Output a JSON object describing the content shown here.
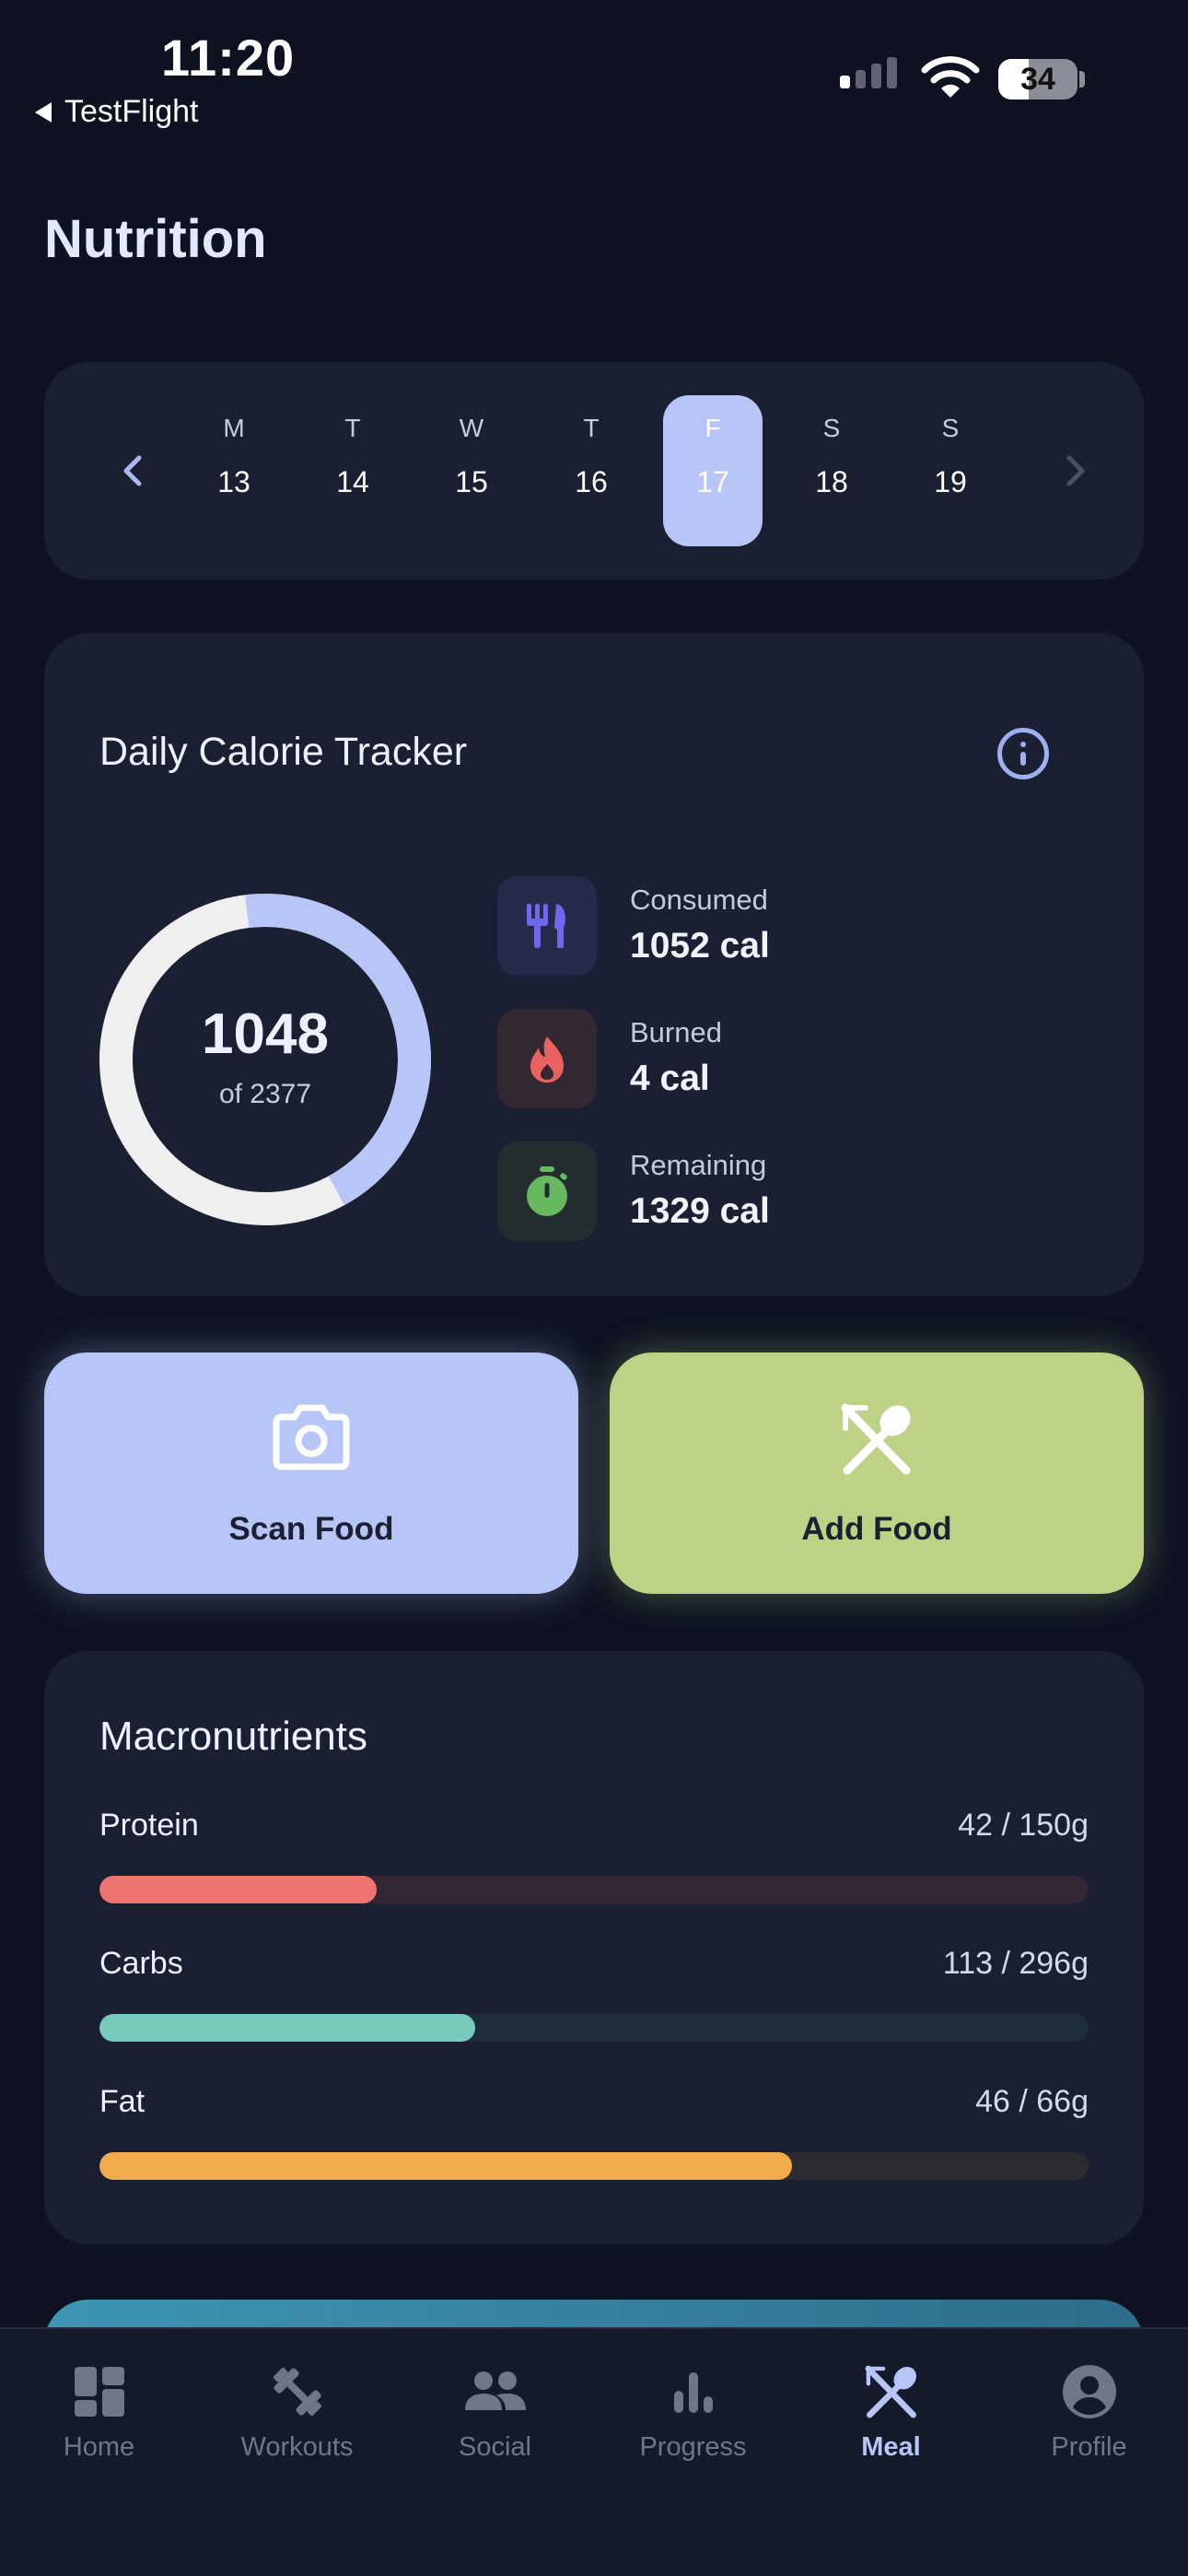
{
  "status_bar": {
    "time": "11:20",
    "back_app": "TestFlight",
    "battery": "34"
  },
  "page": {
    "title": "Nutrition"
  },
  "week": {
    "days": [
      {
        "letter": "M",
        "num": "13"
      },
      {
        "letter": "T",
        "num": "14"
      },
      {
        "letter": "W",
        "num": "15"
      },
      {
        "letter": "T",
        "num": "16"
      },
      {
        "letter": "F",
        "num": "17"
      },
      {
        "letter": "S",
        "num": "18"
      },
      {
        "letter": "S",
        "num": "19"
      }
    ],
    "selected_index": 4
  },
  "calorie_tracker": {
    "title": "Daily Calorie Tracker",
    "ring_value": "1048",
    "ring_goal_text": "of 2377",
    "ring_progress": 0.44,
    "stats": [
      {
        "label": "Consumed",
        "value": "1052 cal",
        "icon": "fork-knife-icon",
        "color": "#6f67ec"
      },
      {
        "label": "Burned",
        "value": "4 cal",
        "icon": "flame-icon",
        "color": "#e8625f"
      },
      {
        "label": "Remaining",
        "value": "1329 cal",
        "icon": "stopwatch-icon",
        "color": "#66b95e"
      }
    ]
  },
  "actions": {
    "scan": "Scan Food",
    "add": "Add Food"
  },
  "macros": {
    "title": "Macronutrients",
    "items": [
      {
        "name": "Protein",
        "amount": "42 / 150g",
        "progress": 0.28,
        "color": "#ee7470",
        "track": "#352636"
      },
      {
        "name": "Carbs",
        "amount": "113 / 296g",
        "progress": 0.38,
        "color": "#76cbbd",
        "track": "#1f2c3a"
      },
      {
        "name": "Fat",
        "amount": "46 / 66g",
        "progress": 0.7,
        "color": "#f2ab4a",
        "track": "#2c2c30"
      }
    ]
  },
  "tabs": [
    {
      "label": "Home",
      "icon": "dashboard-icon"
    },
    {
      "label": "Workouts",
      "icon": "dumbbell-icon"
    },
    {
      "label": "Social",
      "icon": "people-icon"
    },
    {
      "label": "Progress",
      "icon": "bar-chart-icon"
    },
    {
      "label": "Meal",
      "icon": "fork-spoon-icon",
      "active": true
    },
    {
      "label": "Profile",
      "icon": "account-circle-icon"
    }
  ]
}
